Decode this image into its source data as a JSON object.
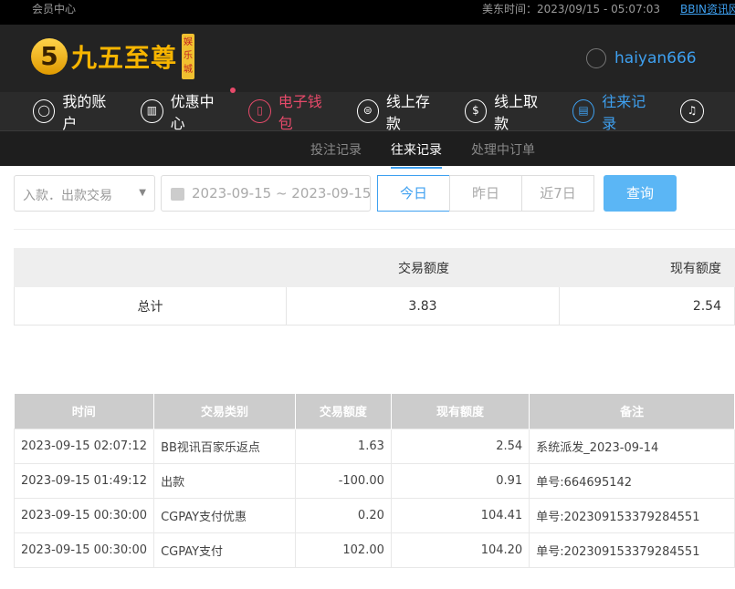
{
  "topbar": {
    "title": "会员中心",
    "time": "美东时间：2023/09/15 - 05:07:03",
    "link": "BBIN资讯网"
  },
  "header": {
    "logo_text": "九五至尊",
    "logo_badge": "娱乐城",
    "logo_num": "5",
    "username": "haiyan666"
  },
  "nav": [
    {
      "label": "我的账户"
    },
    {
      "label": "优惠中心"
    },
    {
      "label": "电子钱包"
    },
    {
      "label": "线上存款"
    },
    {
      "label": "线上取款"
    },
    {
      "label": "往来记录"
    }
  ],
  "subnav": [
    "投注记录",
    "往来记录",
    "处理中订单"
  ],
  "filter": {
    "type": "入款．出款交易",
    "date_range": "2023-09-15 ~ 2023-09-15",
    "today": "今日",
    "yesterday": "昨日",
    "week": "近7日",
    "query": "查询"
  },
  "summary": {
    "headers": [
      "交易额度",
      "现有额度"
    ],
    "label": "总计",
    "amount": "3.83",
    "balance": "2.54"
  },
  "table": {
    "headers": [
      "时间",
      "交易类别",
      "交易额度",
      "现有额度",
      "备注"
    ],
    "rows": [
      [
        "2023-09-15 02:07:12",
        "BB视讯百家乐返点",
        "1.63",
        "2.54",
        "系统派发_2023-09-14"
      ],
      [
        "2023-09-15 01:49:12",
        "出款",
        "-100.00",
        "0.91",
        "单号:664695142"
      ],
      [
        "2023-09-15 00:30:00",
        "CGPAY支付优惠",
        "0.20",
        "104.41",
        "单号:20230915337928455​1"
      ],
      [
        "2023-09-15 00:30:00",
        "CGPAY支付",
        "102.00",
        "104.20",
        "单号:202309153379284551"
      ]
    ]
  }
}
